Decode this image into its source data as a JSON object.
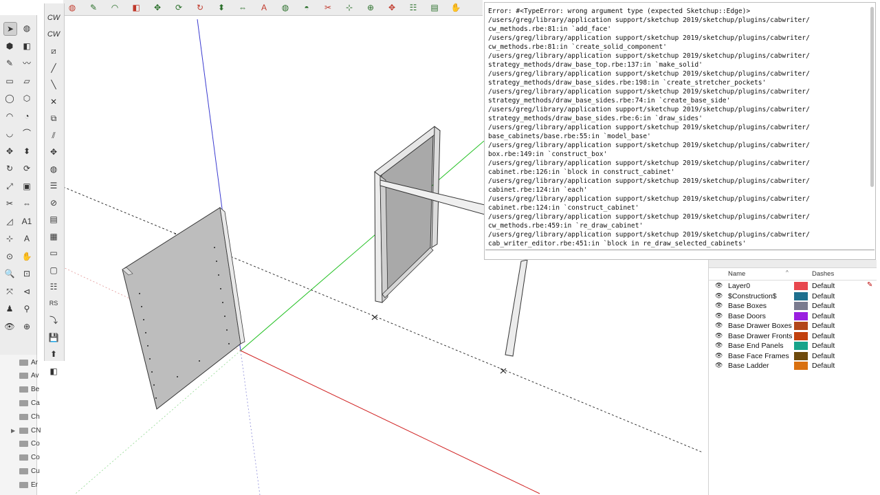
{
  "toolbar": {
    "left_icons": [
      "select-arrow-icon",
      "paint-bucket-icon",
      "paint-icon",
      "eraser-icon",
      "pencil-icon",
      "freehand-icon",
      "rectangle-icon",
      "rotated-rectangle-icon",
      "circle-icon",
      "polygon-icon",
      "arc-icon",
      "pie-icon",
      "two-point-arc-icon",
      "three-point-arc-icon",
      "move-icon",
      "push-pull-icon",
      "rotate-icon",
      "follow-me-icon",
      "scale-icon",
      "offset-icon",
      "tape-measure-icon",
      "dimension-icon",
      "protractor-icon",
      "text-icon",
      "axes-icon",
      "3d-text-icon",
      "orbit-icon",
      "pan-icon",
      "zoom-icon",
      "zoom-window-icon",
      "zoom-extents-icon",
      "zoom-previous-icon",
      "position-camera-icon",
      "walk-icon",
      "look-around-icon",
      "section-plane-icon"
    ],
    "left_symbols": [
      "➤",
      "◍",
      "⬢",
      "◧",
      "✎",
      "〰",
      "▭",
      "▱",
      "◯",
      "⬡",
      "◠",
      "◔",
      "◡",
      "⌒",
      "✥",
      "⬍",
      "↻",
      "⟳",
      "⤢",
      "▣",
      "✂",
      "⇔",
      "◿",
      "A1",
      "⊹",
      "A",
      "⊙",
      "✋",
      "🔍",
      "⊡",
      "⤧",
      "⊲",
      "♟",
      "⚲",
      "👁",
      "⊕"
    ],
    "right_labels": [
      "CW",
      "CW"
    ],
    "right_icons": [
      "cw-edit-icon",
      "cw-line-icon",
      "cw-line2-icon",
      "cw-cross-icon",
      "cw-group-icon",
      "cw-split-icon",
      "cw-move-icon",
      "cw-paint-icon",
      "cw-list-icon",
      "cw-tag-icon",
      "cw-book-icon",
      "cw-grid-icon",
      "cw-page-icon",
      "cw-page2-icon",
      "cw-stack-icon",
      "cw-rs-icon",
      "cw-import-icon",
      "cw-save-icon",
      "cw-export-icon",
      "cw-cube-icon"
    ],
    "right_symbols": [
      "⧄",
      "╱",
      "╲",
      "✕",
      "⧉",
      "⫽",
      "✥",
      "◍",
      "☰",
      "⊘",
      "▤",
      "▦",
      "▭",
      "▢",
      "☷",
      "RS",
      "⤵",
      "💾",
      "⬆",
      "◧"
    ],
    "right_symbol_labels": [
      "RS"
    ],
    "top_icons": [
      "paint-bucket-icon",
      "pencil-icon",
      "arc-icon",
      "eraser-icon",
      "move-icon",
      "follow-me-icon",
      "rotate-icon",
      "push-pull-icon",
      "dimension-icon",
      "text-icon",
      "paint-icon",
      "section-icon",
      "tape-icon",
      "extension-icon",
      "axes-icon",
      "move-cross-icon",
      "layers-icon",
      "stack-icon",
      "hand-icon"
    ]
  },
  "folders": {
    "items": [
      {
        "label": "Ar",
        "expanded": false
      },
      {
        "label": "Av",
        "expanded": false
      },
      {
        "label": "Be",
        "expanded": false
      },
      {
        "label": "Ca",
        "expanded": false
      },
      {
        "label": "Ch",
        "expanded": false
      },
      {
        "label": "CN",
        "expanded": true
      },
      {
        "label": "Co",
        "expanded": false
      },
      {
        "label": "Co",
        "expanded": false
      },
      {
        "label": "Cu",
        "expanded": false
      },
      {
        "label": "Er",
        "expanded": false
      }
    ]
  },
  "console": {
    "lines": [
      "Error: #<TypeError: wrong argument type (expected Sketchup::Edge)>",
      "/users/greg/library/application support/sketchup 2019/sketchup/plugins/cabwriter/",
      "cw_methods.rbe:81:in `add_face'",
      "/users/greg/library/application support/sketchup 2019/sketchup/plugins/cabwriter/",
      "cw_methods.rbe:81:in `create_solid_component'",
      "/users/greg/library/application support/sketchup 2019/sketchup/plugins/cabwriter/",
      "strategy_methods/draw_base_top.rbe:137:in `make_solid'",
      "/users/greg/library/application support/sketchup 2019/sketchup/plugins/cabwriter/",
      "strategy_methods/draw_base_sides.rbe:198:in `create_stretcher_pockets'",
      "/users/greg/library/application support/sketchup 2019/sketchup/plugins/cabwriter/",
      "strategy_methods/draw_base_sides.rbe:74:in `create_base_side'",
      "/users/greg/library/application support/sketchup 2019/sketchup/plugins/cabwriter/",
      "strategy_methods/draw_base_sides.rbe:6:in `draw_sides'",
      "/users/greg/library/application support/sketchup 2019/sketchup/plugins/cabwriter/",
      "base_cabinets/base.rbe:55:in `model_base'",
      "/users/greg/library/application support/sketchup 2019/sketchup/plugins/cabwriter/",
      "box.rbe:149:in `construct_box'",
      "/users/greg/library/application support/sketchup 2019/sketchup/plugins/cabwriter/",
      "cabinet.rbe:126:in `block in construct_cabinet'",
      "/users/greg/library/application support/sketchup 2019/sketchup/plugins/cabwriter/",
      "cabinet.rbe:124:in `each'",
      "/users/greg/library/application support/sketchup 2019/sketchup/plugins/cabwriter/",
      "cabinet.rbe:124:in `construct_cabinet'",
      "/users/greg/library/application support/sketchup 2019/sketchup/plugins/cabwriter/",
      "cw_methods.rbe:459:in `re_draw_cabinet'",
      "/users/greg/library/application support/sketchup 2019/sketchup/plugins/cabwriter/",
      "cab_writer_editor.rbe:451:in `block in re_draw_selected_cabinets'"
    ],
    "input_value": ""
  },
  "layers": {
    "header_name": "Name",
    "header_dashes": "Dashes",
    "rows": [
      {
        "name": "Layer0",
        "color": "#e8474e",
        "dashes": "Default",
        "active": true
      },
      {
        "name": "$Construction$",
        "color": "#1f6f8e",
        "dashes": "Default",
        "active": false
      },
      {
        "name": "Base Boxes",
        "color": "#7a7b8f",
        "dashes": "Default",
        "active": false
      },
      {
        "name": "Base Doors",
        "color": "#9a1fe0",
        "dashes": "Default",
        "active": false
      },
      {
        "name": "Base Drawer Boxes",
        "color": "#b3461a",
        "dashes": "Default",
        "active": false
      },
      {
        "name": "Base Drawer Fronts",
        "color": "#c2410e",
        "dashes": "Default",
        "active": false
      },
      {
        "name": "Base End Panels",
        "color": "#18a38a",
        "dashes": "Default",
        "active": false
      },
      {
        "name": "Base Face Frames",
        "color": "#6e4a0d",
        "dashes": "Default",
        "active": false
      },
      {
        "name": "Base Ladder",
        "color": "#d9700f",
        "dashes": "Default",
        "active": false
      }
    ]
  }
}
